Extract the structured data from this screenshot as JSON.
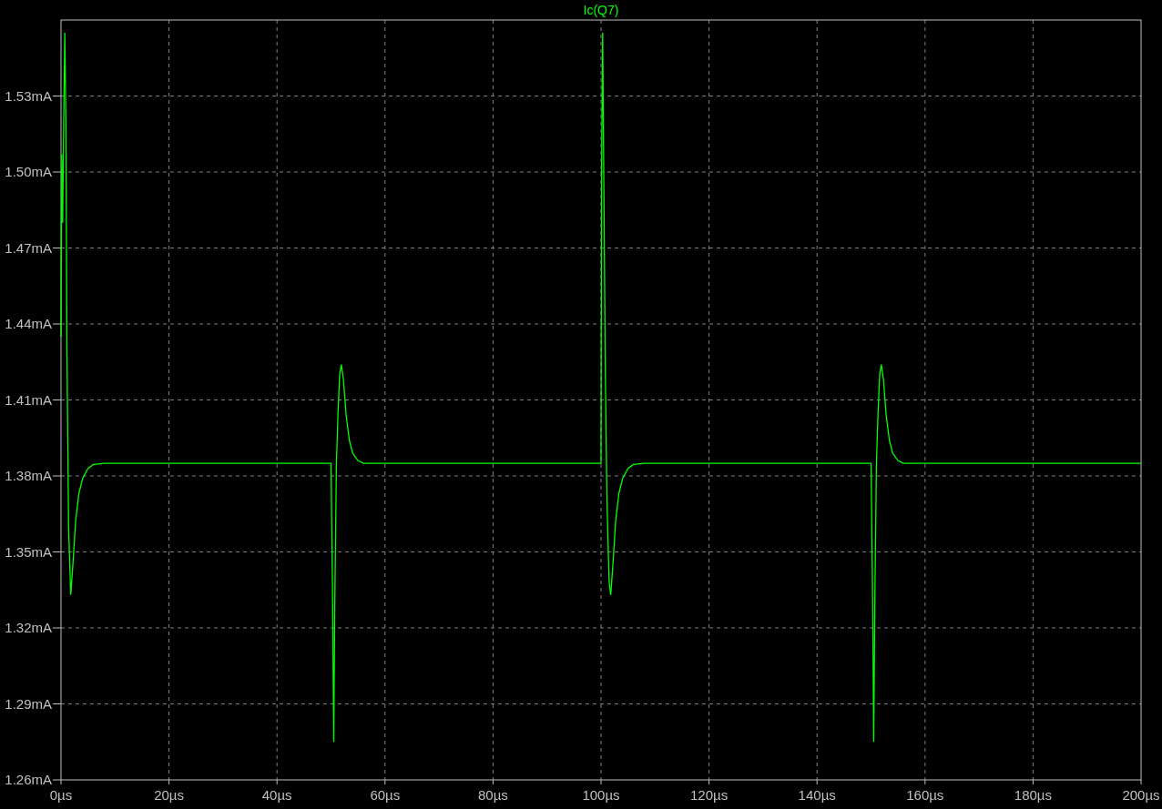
{
  "chart_data": {
    "type": "line",
    "grid": true,
    "xlim": [
      0,
      200
    ],
    "ylim": [
      1.26,
      1.56
    ],
    "xticks": [
      {
        "value": 0,
        "label": "0µs"
      },
      {
        "value": 20,
        "label": "20µs"
      },
      {
        "value": 40,
        "label": "40µs"
      },
      {
        "value": 60,
        "label": "60µs"
      },
      {
        "value": 80,
        "label": "80µs"
      },
      {
        "value": 100,
        "label": "100µs"
      },
      {
        "value": 120,
        "label": "120µs"
      },
      {
        "value": 140,
        "label": "140µs"
      },
      {
        "value": 160,
        "label": "160µs"
      },
      {
        "value": 180,
        "label": "180µs"
      },
      {
        "value": 200,
        "label": "200µs"
      }
    ],
    "yticks": [
      {
        "value": 1.26,
        "label": "1.26mA"
      },
      {
        "value": 1.29,
        "label": "1.29mA"
      },
      {
        "value": 1.32,
        "label": "1.32mA"
      },
      {
        "value": 1.35,
        "label": "1.35mA"
      },
      {
        "value": 1.38,
        "label": "1.38mA"
      },
      {
        "value": 1.41,
        "label": "1.41mA"
      },
      {
        "value": 1.44,
        "label": "1.44mA"
      },
      {
        "value": 1.47,
        "label": "1.47mA"
      },
      {
        "value": 1.5,
        "label": "1.50mA"
      },
      {
        "value": 1.53,
        "label": "1.53mA"
      }
    ],
    "x": [
      0,
      0.15,
      0.3,
      0.5,
      0.7,
      0.9,
      1.1,
      1.4,
      1.8,
      2.2,
      2.7,
      3.3,
      4,
      5,
      6,
      8,
      50,
      50.3,
      50.5,
      50.7,
      51,
      51.3,
      51.6,
      51.9,
      52.3,
      52.8,
      53.4,
      54,
      55,
      56,
      100,
      100.1,
      100.3,
      100.5,
      100.8,
      101.1,
      101.5,
      101.8,
      102.2,
      102.7,
      103.3,
      104,
      105,
      106,
      108,
      150,
      150.3,
      150.5,
      150.7,
      151,
      151.3,
      151.6,
      151.9,
      152.3,
      152.8,
      153.4,
      154,
      155,
      156,
      200
    ],
    "series": [
      {
        "name": "Ic(Q7)",
        "color": "#00ff00",
        "values": [
          1.435,
          1.507,
          1.48,
          1.52,
          1.555,
          1.52,
          1.43,
          1.36,
          1.333,
          1.345,
          1.362,
          1.373,
          1.379,
          1.383,
          1.3845,
          1.385,
          1.385,
          1.33,
          1.275,
          1.33,
          1.385,
          1.405,
          1.42,
          1.424,
          1.418,
          1.404,
          1.394,
          1.389,
          1.386,
          1.385,
          1.385,
          1.5,
          1.555,
          1.5,
          1.42,
          1.37,
          1.338,
          1.333,
          1.345,
          1.362,
          1.373,
          1.379,
          1.383,
          1.3845,
          1.385,
          1.385,
          1.33,
          1.275,
          1.33,
          1.385,
          1.405,
          1.42,
          1.424,
          1.418,
          1.404,
          1.394,
          1.389,
          1.386,
          1.385,
          1.385
        ]
      }
    ]
  }
}
